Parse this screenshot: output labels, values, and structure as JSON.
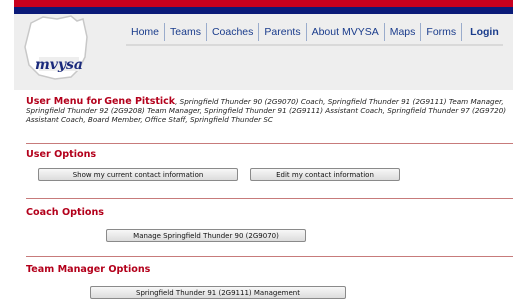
{
  "brand": {
    "logo_text": "mvysa",
    "red": "#c8001e",
    "navy": "#0a1a78"
  },
  "nav": {
    "items": [
      "Home",
      "Teams",
      "Coaches",
      "Parents",
      "About MVYSA",
      "Maps",
      "Forms"
    ],
    "login": "Login"
  },
  "user_menu": {
    "title": "User Menu for",
    "name": "Gene Pitstick",
    "roles": ", Springfield Thunder 90 (2G9070) Coach, Springfield Thunder 91 (2G9111) Team Manager, Springfield Thunder 92 (2G9208) Team Manager, Springfield Thunder 91 (2G9111) Assistant Coach, Springfield Thunder 97 (2G9720) Assistant Coach, Board Member, Office Staff, Springfield Thunder SC"
  },
  "user_options": {
    "title": "User Options",
    "show_contact": "Show my current contact information",
    "edit_contact": "Edit my contact information"
  },
  "coach_options": {
    "title": "Coach Options",
    "manage_team": "Manage Springfield Thunder 90 (2G9070)"
  },
  "team_manager_options": {
    "title": "Team Manager Options",
    "management": "Springfield Thunder 91 (2G9111) Management"
  }
}
